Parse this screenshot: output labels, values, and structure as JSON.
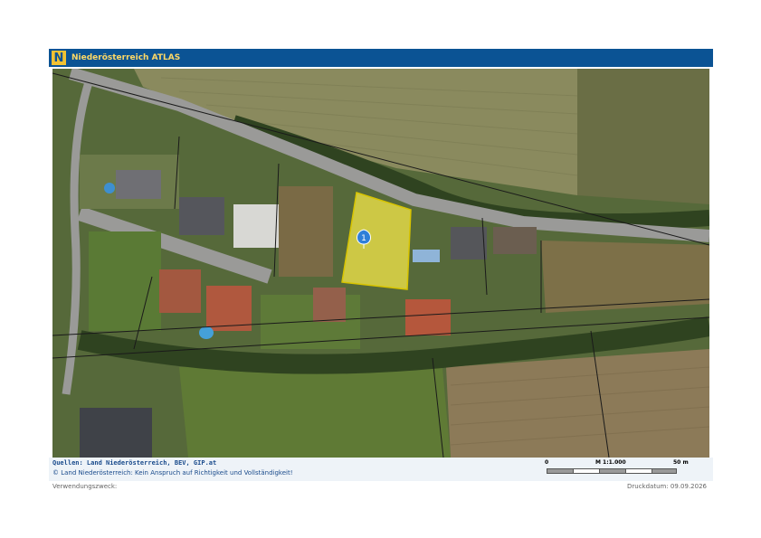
{
  "header": {
    "logo_letter": "N",
    "title": "Niederösterreich ATLAS"
  },
  "map": {
    "marker_label": "1",
    "parcel_color": "#f5e84a",
    "marker_color": "#2f7fd8"
  },
  "footer": {
    "sources": "Quellen: Land Niederösterreich, BEV, GIP.at",
    "copyright": "© Land Niederösterreich: Kein Anspruch auf Richtigkeit und Vollständigkeit!",
    "scale": {
      "start": "0",
      "ratio": "M 1:1.000",
      "end": "50 m"
    },
    "purpose": "Verwendungszweck:",
    "print_date": "Druckdatum: 09.09.2026"
  },
  "colors": {
    "header_bg": "#0b5394",
    "header_text": "#ffd966",
    "footer_text": "#1a4b8c"
  }
}
